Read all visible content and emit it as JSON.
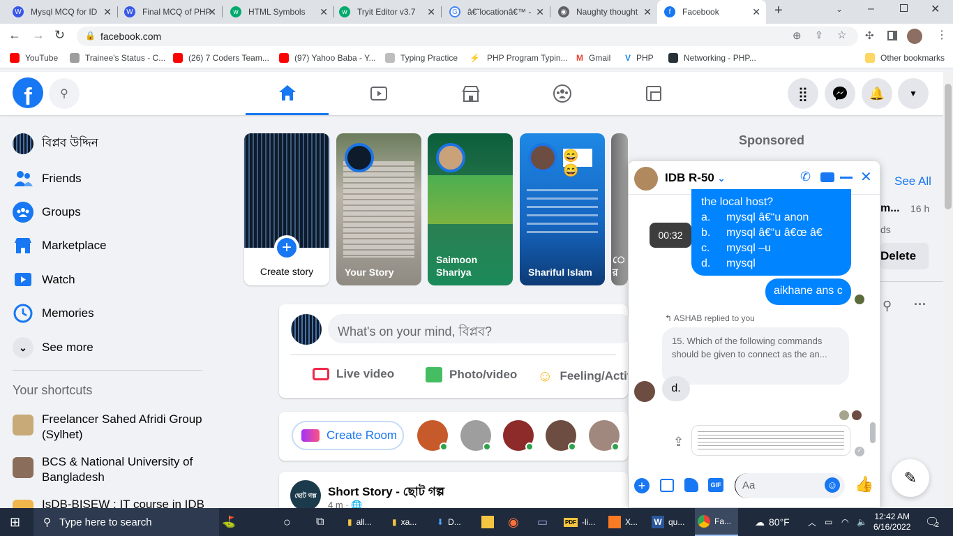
{
  "browser": {
    "tabs": [
      {
        "title": "Mysql MCQ for ID",
        "icon": "wordpress-icon"
      },
      {
        "title": "Final MCQ of PHP",
        "icon": "wordpress-icon"
      },
      {
        "title": "HTML Symbols",
        "icon": "w3schools-icon"
      },
      {
        "title": "Tryit Editor v3.7",
        "icon": "w3schools-icon"
      },
      {
        "title": "â€˜locationâ€™ -",
        "icon": "google-icon"
      },
      {
        "title": "Naughty thought",
        "icon": "web-icon"
      },
      {
        "title": "Facebook",
        "icon": "facebook-icon"
      }
    ],
    "url": "facebook.com",
    "bookmarks": [
      "YouTube",
      "Trainee's Status - C...",
      "(26) 7 Coders Team...",
      "(97) Yahoo Baba - Y...",
      "Typing Practice",
      "PHP Program Typin...",
      "Gmail",
      "PHP",
      "Networking - PHP..."
    ],
    "other_bookmarks": "Other bookmarks"
  },
  "sidebar": {
    "profile_name": "বিপ্লব উদ্দিন",
    "items": [
      "Friends",
      "Groups",
      "Marketplace",
      "Watch",
      "Memories",
      "See more"
    ],
    "shortcuts_title": "Your shortcuts",
    "shortcuts": [
      "Freelancer Sahed Afridi Group (Sylhet)",
      "BCS & National University of Bangladesh",
      "IsDB-BISEW : IT course in IDB"
    ]
  },
  "stories": {
    "create_label": "Create story",
    "items": [
      {
        "name": "Your Story"
      },
      {
        "name": "Saimoon Shariya"
      },
      {
        "name": "Shariful Islam"
      },
      {
        "name": "ে র"
      }
    ]
  },
  "composer": {
    "placeholder": "What's on your mind, বিপ্লব?",
    "live": "Live video",
    "photo": "Photo/video",
    "feeling": "Feeling/Activ"
  },
  "rooms": {
    "create_room": "Create Room"
  },
  "post": {
    "title": "Short Story - ছোট গল্প",
    "meta": "4 m · ",
    "avatar_text": "ছোট গল্প"
  },
  "right": {
    "sponsored": "Sponsored",
    "see_all": "See All",
    "notif_name": "m...",
    "notif_time": "16 h",
    "notif_sub": "ds",
    "delete": "Delete"
  },
  "chat": {
    "title": "IDB R-50",
    "timestamp_tooltip": "00:32",
    "question_tail": "the local host?",
    "options": [
      {
        "letter": "a.",
        "text": "mysql â€“u anon"
      },
      {
        "letter": "b.",
        "text": "mysql â€“u â€œ â€"
      },
      {
        "letter": "c.",
        "text": "mysql –u"
      },
      {
        "letter": "d.",
        "text": "mysql"
      }
    ],
    "my_reply": "aikhane ans c",
    "replied_label": "ASHAB replied to you",
    "quoted_text": "15.   Which of the following commands should be given to connect as the an...",
    "their_reply": "d.",
    "input_placeholder": "Aa"
  },
  "taskbar": {
    "search_placeholder": "Type here to search",
    "apps": [
      "all...",
      "xa...",
      "D...",
      "",
      "",
      "",
      "-li...",
      "X...",
      "qu...",
      "Fa..."
    ],
    "weather": "80°F",
    "time": "12:42 AM",
    "date": "6/16/2022",
    "notifications": "2"
  },
  "colors": {
    "fb_blue": "#1877f2",
    "messenger_blue": "#0084ff",
    "taskbar": "#1f2a3c"
  }
}
